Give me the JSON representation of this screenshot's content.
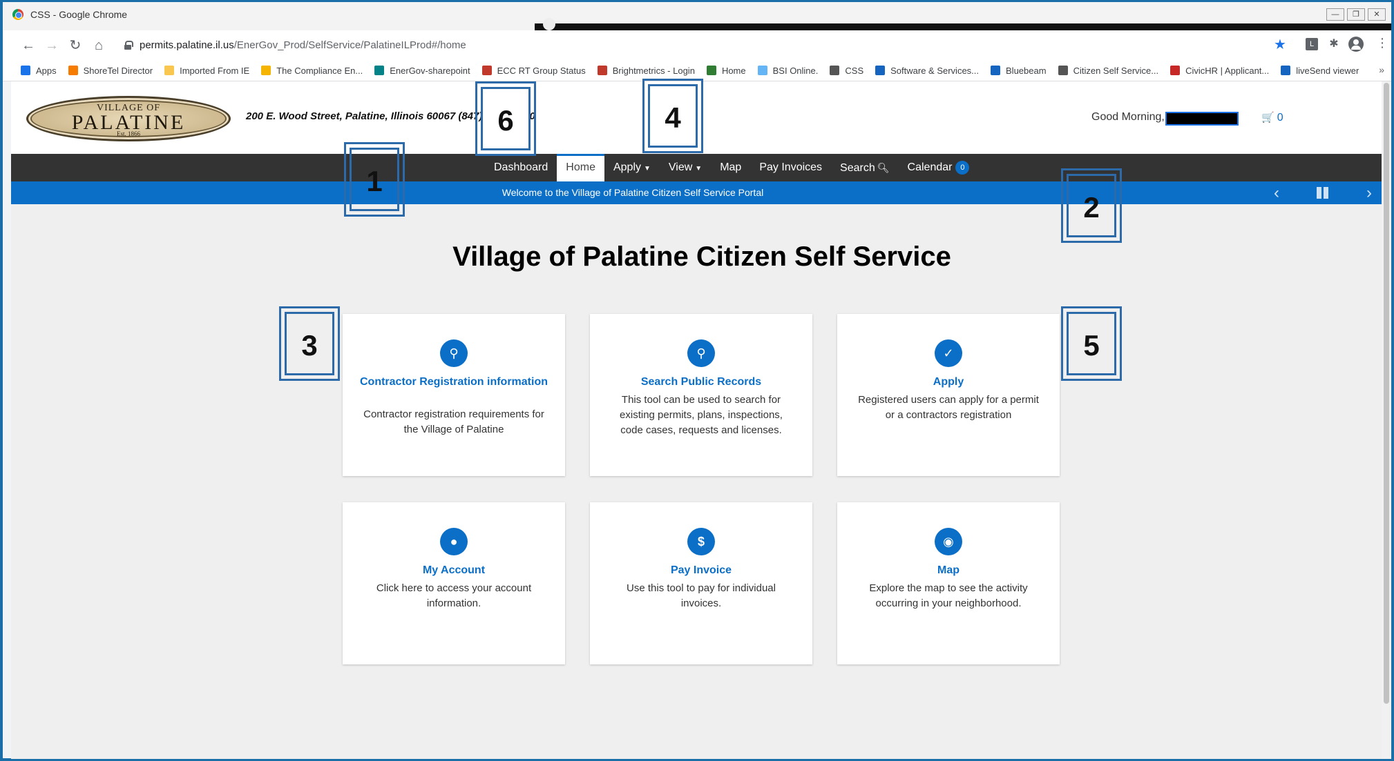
{
  "window": {
    "title": "CSS - Google Chrome"
  },
  "browser": {
    "url_host": "permits.palatine.il.us",
    "url_path": "/EnerGov_Prod/SelfService/PalatineILProd#/home",
    "bookmarks": [
      {
        "label": "Apps",
        "color": "#1a73e8"
      },
      {
        "label": "ShoreTel Director",
        "color": "#f57c00"
      },
      {
        "label": "Imported From IE",
        "color": "#f9c74f"
      },
      {
        "label": "The Compliance En...",
        "color": "#f4b400"
      },
      {
        "label": "EnerGov-sharepoint",
        "color": "#038387"
      },
      {
        "label": "ECC RT Group Status",
        "color": "#c0392b"
      },
      {
        "label": "Brightmetrics - Login",
        "color": "#c0392b"
      },
      {
        "label": "Home",
        "color": "#2e7d32"
      },
      {
        "label": "BSI Online.",
        "color": "#64b5f6"
      },
      {
        "label": "CSS",
        "color": "#555555"
      },
      {
        "label": "Software & Services...",
        "color": "#1565c0"
      },
      {
        "label": "Bluebeam",
        "color": "#1565c0"
      },
      {
        "label": "Citizen Self Service...",
        "color": "#555555"
      },
      {
        "label": "CivicHR | Applicant...",
        "color": "#c62828"
      },
      {
        "label": "liveSend viewer",
        "color": "#1565c0"
      }
    ],
    "more_label": "»"
  },
  "header": {
    "logo_top": "VILLAGE OF",
    "logo_main": "PALATINE",
    "logo_est": "Est. 1866",
    "address": "200 E. Wood Street, Palatine, Illinois 60067  (847)",
    "address_tail": "0",
    "greeting": "Good Morning,",
    "cart_count": "0"
  },
  "nav": {
    "dashboard": "Dashboard",
    "home": "Home",
    "apply": "Apply",
    "view": "View",
    "map": "Map",
    "pay_invoices": "Pay Invoices",
    "search": "Search",
    "calendar": "Calendar",
    "calendar_badge": "0"
  },
  "banner": {
    "text": "Welcome to the Village of Palatine Citizen Self Service Portal"
  },
  "page_title": "Village of Palatine Citizen Self Service",
  "cards": [
    {
      "title": "Contractor Registration information",
      "desc": "Contractor registration requirements for the Village of Palatine",
      "icon": "search-icon"
    },
    {
      "title": "Search Public Records",
      "desc": "This tool can be used to search for existing permits, plans, inspections, code cases, requests and licenses.",
      "icon": "search-icon"
    },
    {
      "title": "Apply",
      "desc": "Registered users can apply for a permit or a contractors registration",
      "icon": "clipboard-check-icon"
    },
    {
      "title": "My Account",
      "desc": "Click here to access your account information.",
      "icon": "user-icon"
    },
    {
      "title": "Pay Invoice",
      "desc": "Use this tool to pay for individual invoices.",
      "icon": "dollar-icon"
    },
    {
      "title": "Map",
      "desc": "Explore the map to see the activity occurring in your neighborhood.",
      "icon": "map-pin-icon"
    }
  ],
  "annotations": [
    "1",
    "2",
    "3",
    "4",
    "5",
    "6"
  ],
  "colors": {
    "accent": "#0b6fc7",
    "nav_bg": "#333333",
    "annotation": "#2d6aa9"
  }
}
